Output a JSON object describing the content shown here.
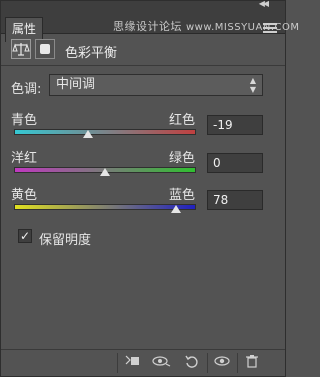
{
  "panel": {
    "tab_label": "属性",
    "watermark": "思缘设计论坛",
    "watermark_url": "www.MISSYUAN.COM",
    "title": "色彩平衡",
    "header_icons": [
      "balance-scale-icon",
      "mask-icon"
    ]
  },
  "tone": {
    "label": "色调:",
    "value": "中间调"
  },
  "sliders": [
    {
      "left": "青色",
      "right": "红色",
      "value": "-19",
      "fraction": 0.405,
      "gradient": [
        "#35c8d3",
        "#c04040"
      ]
    },
    {
      "left": "洋红",
      "right": "绿色",
      "value": "0",
      "fraction": 0.5,
      "gradient": [
        "#c038c0",
        "#30c030"
      ]
    },
    {
      "left": "黄色",
      "right": "蓝色",
      "value": "78",
      "fraction": 0.89,
      "gradient": [
        "#e0e020",
        "#2020c0"
      ]
    }
  ],
  "preserve": {
    "label": "保留明度",
    "checked": true,
    "mark": "✓"
  },
  "footer_icons": [
    "clip-to-layer-icon",
    "view-previous-icon",
    "reset-icon",
    "visibility-icon",
    "trash-icon"
  ]
}
